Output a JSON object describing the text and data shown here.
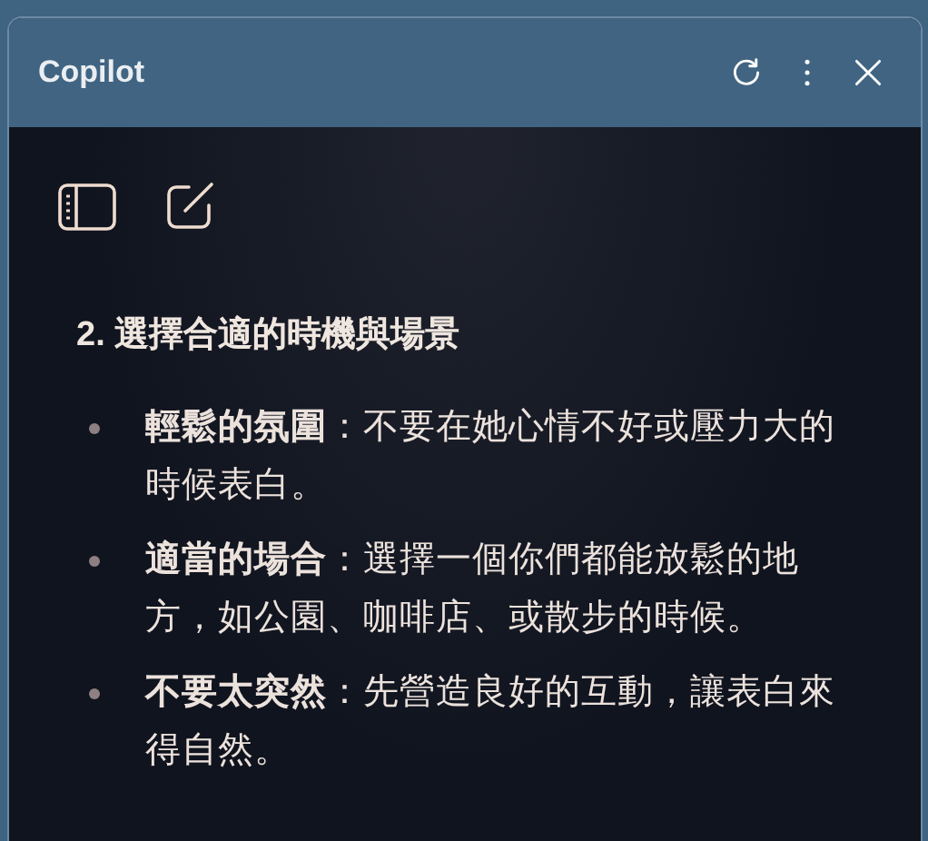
{
  "window": {
    "title": "Copilot"
  },
  "section": {
    "heading": "2. 選擇合適的時機與場景",
    "items": [
      "**輕鬆的氛圍**：不要在她心情不好或壓力大的時候表白。",
      "**適當的場合**：選擇一個你們都能放鬆的地方，如公園、咖啡店、或散步的時候。",
      "**不要太突然**：先營造良好的互動，讓表白來得自然。"
    ]
  }
}
